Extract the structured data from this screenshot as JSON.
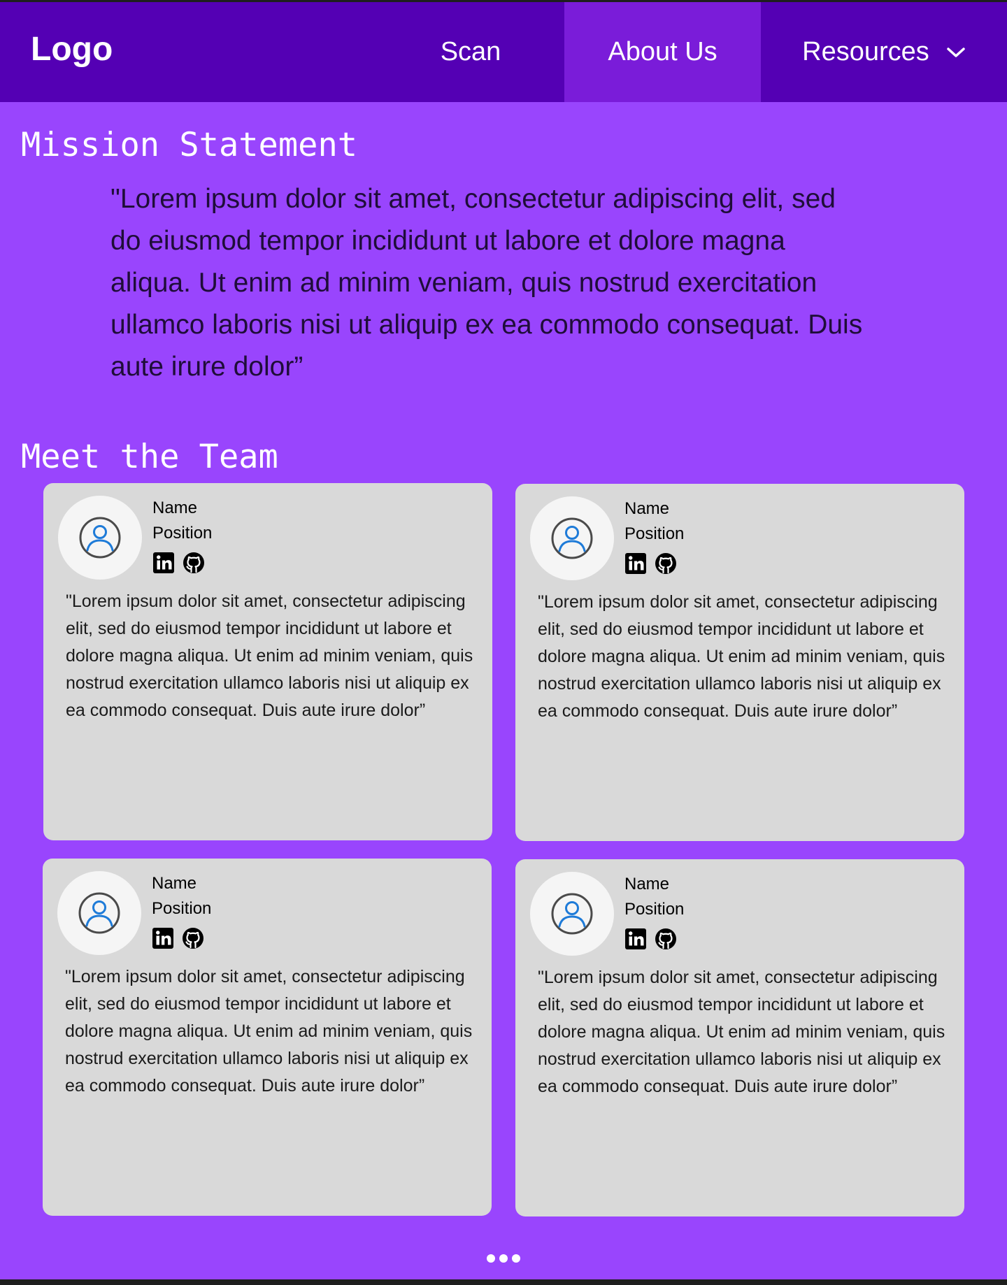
{
  "nav": {
    "logo": "Logo",
    "items": [
      {
        "label": "Scan"
      },
      {
        "label": "About Us",
        "active": true
      },
      {
        "label": "Resources",
        "icon": "chevron-down-icon"
      }
    ]
  },
  "mission": {
    "title": "Mission Statement",
    "text": "\"Lorem ipsum dolor sit amet, consectetur adipiscing elit, sed do eiusmod tempor incididunt ut labore et dolore magna aliqua. Ut enim ad minim veniam, quis nostrud exercitation ullamco laboris nisi ut aliquip ex ea commodo consequat. Duis aute irure dolor”"
  },
  "team": {
    "title": "Meet the Team",
    "members": [
      {
        "name": "Name",
        "position": "Position",
        "bio": "\"Lorem ipsum dolor sit amet, consectetur adipiscing elit, sed do eiusmod tempor incididunt ut labore et dolore magna aliqua. Ut enim ad minim veniam, quis nostrud exercitation ullamco laboris nisi ut aliquip ex ea commodo consequat. Duis aute irure dolor”",
        "icons": [
          "user-avatar-icon",
          "linkedin-icon",
          "github-icon"
        ]
      },
      {
        "name": "Name",
        "position": "Position",
        "bio": "\"Lorem ipsum dolor sit amet, consectetur adipiscing elit, sed do eiusmod tempor incididunt ut labore et dolore magna aliqua. Ut enim ad minim veniam, quis nostrud exercitation ullamco laboris nisi ut aliquip ex ea commodo consequat. Duis aute irure dolor”",
        "icons": [
          "user-avatar-icon",
          "linkedin-icon",
          "github-icon"
        ]
      },
      {
        "name": "Name",
        "position": "Position",
        "bio": "\"Lorem ipsum dolor sit amet, consectetur adipiscing elit, sed do eiusmod tempor incididunt ut labore et dolore magna aliqua. Ut enim ad minim veniam, quis nostrud exercitation ullamco laboris nisi ut aliquip ex ea commodo consequat. Duis aute irure dolor”",
        "icons": [
          "user-avatar-icon",
          "linkedin-icon",
          "github-icon"
        ]
      },
      {
        "name": "Name",
        "position": "Position",
        "bio": "\"Lorem ipsum dolor sit amet, consectetur adipiscing elit, sed do eiusmod tempor incididunt ut labore et dolore magna aliqua. Ut enim ad minim veniam, quis nostrud exercitation ullamco laboris nisi ut aliquip ex ea commodo consequat. Duis aute irure dolor”",
        "icons": [
          "user-avatar-icon",
          "linkedin-icon",
          "github-icon"
        ]
      }
    ]
  },
  "pagination": {
    "icon": "more-dots-icon"
  },
  "colors": {
    "page_background": "#9945fd",
    "navbar": "#5400b4",
    "nav_active": "#7a1cd9",
    "card": "#d9d9d9",
    "avatar_circle": "#f5f5f5",
    "avatar_accent": "#1e7bd8"
  }
}
